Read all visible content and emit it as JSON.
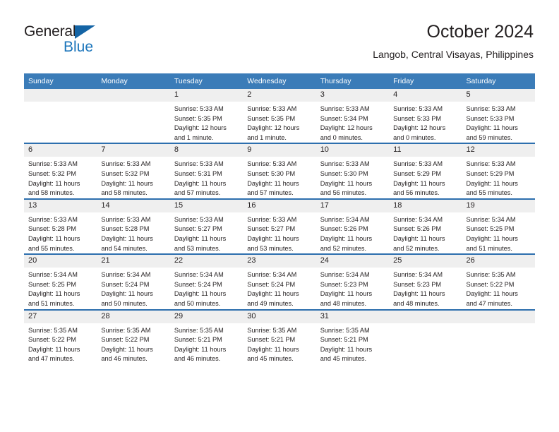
{
  "brand": {
    "name_part1": "General",
    "name_part2": "Blue",
    "triangle_color": "#1464a5",
    "blue_text_color": "#1b75bb"
  },
  "header": {
    "title": "October 2024",
    "subtitle": "Langob, Central Visayas, Philippines"
  },
  "theme": {
    "header_row_bg": "#3b7cb8",
    "week_divider": "#2d6fae",
    "daynum_bg": "#efefef",
    "text": "#231f20"
  },
  "weekday_headers": [
    "Sunday",
    "Monday",
    "Tuesday",
    "Wednesday",
    "Thursday",
    "Friday",
    "Saturday"
  ],
  "weeks": [
    [
      {
        "day": "",
        "sunrise": "",
        "sunset": "",
        "daylight1": "",
        "daylight2": ""
      },
      {
        "day": "",
        "sunrise": "",
        "sunset": "",
        "daylight1": "",
        "daylight2": ""
      },
      {
        "day": "1",
        "sunrise": "Sunrise: 5:33 AM",
        "sunset": "Sunset: 5:35 PM",
        "daylight1": "Daylight: 12 hours",
        "daylight2": "and 1 minute."
      },
      {
        "day": "2",
        "sunrise": "Sunrise: 5:33 AM",
        "sunset": "Sunset: 5:35 PM",
        "daylight1": "Daylight: 12 hours",
        "daylight2": "and 1 minute."
      },
      {
        "day": "3",
        "sunrise": "Sunrise: 5:33 AM",
        "sunset": "Sunset: 5:34 PM",
        "daylight1": "Daylight: 12 hours",
        "daylight2": "and 0 minutes."
      },
      {
        "day": "4",
        "sunrise": "Sunrise: 5:33 AM",
        "sunset": "Sunset: 5:33 PM",
        "daylight1": "Daylight: 12 hours",
        "daylight2": "and 0 minutes."
      },
      {
        "day": "5",
        "sunrise": "Sunrise: 5:33 AM",
        "sunset": "Sunset: 5:33 PM",
        "daylight1": "Daylight: 11 hours",
        "daylight2": "and 59 minutes."
      }
    ],
    [
      {
        "day": "6",
        "sunrise": "Sunrise: 5:33 AM",
        "sunset": "Sunset: 5:32 PM",
        "daylight1": "Daylight: 11 hours",
        "daylight2": "and 58 minutes."
      },
      {
        "day": "7",
        "sunrise": "Sunrise: 5:33 AM",
        "sunset": "Sunset: 5:32 PM",
        "daylight1": "Daylight: 11 hours",
        "daylight2": "and 58 minutes."
      },
      {
        "day": "8",
        "sunrise": "Sunrise: 5:33 AM",
        "sunset": "Sunset: 5:31 PM",
        "daylight1": "Daylight: 11 hours",
        "daylight2": "and 57 minutes."
      },
      {
        "day": "9",
        "sunrise": "Sunrise: 5:33 AM",
        "sunset": "Sunset: 5:30 PM",
        "daylight1": "Daylight: 11 hours",
        "daylight2": "and 57 minutes."
      },
      {
        "day": "10",
        "sunrise": "Sunrise: 5:33 AM",
        "sunset": "Sunset: 5:30 PM",
        "daylight1": "Daylight: 11 hours",
        "daylight2": "and 56 minutes."
      },
      {
        "day": "11",
        "sunrise": "Sunrise: 5:33 AM",
        "sunset": "Sunset: 5:29 PM",
        "daylight1": "Daylight: 11 hours",
        "daylight2": "and 56 minutes."
      },
      {
        "day": "12",
        "sunrise": "Sunrise: 5:33 AM",
        "sunset": "Sunset: 5:29 PM",
        "daylight1": "Daylight: 11 hours",
        "daylight2": "and 55 minutes."
      }
    ],
    [
      {
        "day": "13",
        "sunrise": "Sunrise: 5:33 AM",
        "sunset": "Sunset: 5:28 PM",
        "daylight1": "Daylight: 11 hours",
        "daylight2": "and 55 minutes."
      },
      {
        "day": "14",
        "sunrise": "Sunrise: 5:33 AM",
        "sunset": "Sunset: 5:28 PM",
        "daylight1": "Daylight: 11 hours",
        "daylight2": "and 54 minutes."
      },
      {
        "day": "15",
        "sunrise": "Sunrise: 5:33 AM",
        "sunset": "Sunset: 5:27 PM",
        "daylight1": "Daylight: 11 hours",
        "daylight2": "and 53 minutes."
      },
      {
        "day": "16",
        "sunrise": "Sunrise: 5:33 AM",
        "sunset": "Sunset: 5:27 PM",
        "daylight1": "Daylight: 11 hours",
        "daylight2": "and 53 minutes."
      },
      {
        "day": "17",
        "sunrise": "Sunrise: 5:34 AM",
        "sunset": "Sunset: 5:26 PM",
        "daylight1": "Daylight: 11 hours",
        "daylight2": "and 52 minutes."
      },
      {
        "day": "18",
        "sunrise": "Sunrise: 5:34 AM",
        "sunset": "Sunset: 5:26 PM",
        "daylight1": "Daylight: 11 hours",
        "daylight2": "and 52 minutes."
      },
      {
        "day": "19",
        "sunrise": "Sunrise: 5:34 AM",
        "sunset": "Sunset: 5:25 PM",
        "daylight1": "Daylight: 11 hours",
        "daylight2": "and 51 minutes."
      }
    ],
    [
      {
        "day": "20",
        "sunrise": "Sunrise: 5:34 AM",
        "sunset": "Sunset: 5:25 PM",
        "daylight1": "Daylight: 11 hours",
        "daylight2": "and 51 minutes."
      },
      {
        "day": "21",
        "sunrise": "Sunrise: 5:34 AM",
        "sunset": "Sunset: 5:24 PM",
        "daylight1": "Daylight: 11 hours",
        "daylight2": "and 50 minutes."
      },
      {
        "day": "22",
        "sunrise": "Sunrise: 5:34 AM",
        "sunset": "Sunset: 5:24 PM",
        "daylight1": "Daylight: 11 hours",
        "daylight2": "and 50 minutes."
      },
      {
        "day": "23",
        "sunrise": "Sunrise: 5:34 AM",
        "sunset": "Sunset: 5:24 PM",
        "daylight1": "Daylight: 11 hours",
        "daylight2": "and 49 minutes."
      },
      {
        "day": "24",
        "sunrise": "Sunrise: 5:34 AM",
        "sunset": "Sunset: 5:23 PM",
        "daylight1": "Daylight: 11 hours",
        "daylight2": "and 48 minutes."
      },
      {
        "day": "25",
        "sunrise": "Sunrise: 5:34 AM",
        "sunset": "Sunset: 5:23 PM",
        "daylight1": "Daylight: 11 hours",
        "daylight2": "and 48 minutes."
      },
      {
        "day": "26",
        "sunrise": "Sunrise: 5:35 AM",
        "sunset": "Sunset: 5:22 PM",
        "daylight1": "Daylight: 11 hours",
        "daylight2": "and 47 minutes."
      }
    ],
    [
      {
        "day": "27",
        "sunrise": "Sunrise: 5:35 AM",
        "sunset": "Sunset: 5:22 PM",
        "daylight1": "Daylight: 11 hours",
        "daylight2": "and 47 minutes."
      },
      {
        "day": "28",
        "sunrise": "Sunrise: 5:35 AM",
        "sunset": "Sunset: 5:22 PM",
        "daylight1": "Daylight: 11 hours",
        "daylight2": "and 46 minutes."
      },
      {
        "day": "29",
        "sunrise": "Sunrise: 5:35 AM",
        "sunset": "Sunset: 5:21 PM",
        "daylight1": "Daylight: 11 hours",
        "daylight2": "and 46 minutes."
      },
      {
        "day": "30",
        "sunrise": "Sunrise: 5:35 AM",
        "sunset": "Sunset: 5:21 PM",
        "daylight1": "Daylight: 11 hours",
        "daylight2": "and 45 minutes."
      },
      {
        "day": "31",
        "sunrise": "Sunrise: 5:35 AM",
        "sunset": "Sunset: 5:21 PM",
        "daylight1": "Daylight: 11 hours",
        "daylight2": "and 45 minutes."
      },
      {
        "day": "",
        "sunrise": "",
        "sunset": "",
        "daylight1": "",
        "daylight2": ""
      },
      {
        "day": "",
        "sunrise": "",
        "sunset": "",
        "daylight1": "",
        "daylight2": ""
      }
    ]
  ]
}
